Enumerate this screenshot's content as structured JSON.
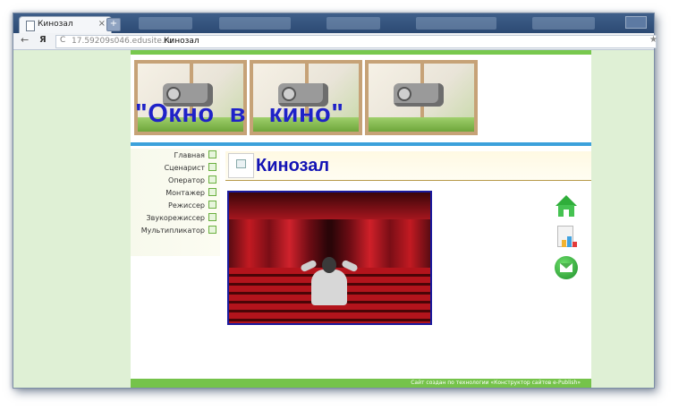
{
  "browser": {
    "tab_title": "Кинозал",
    "tab_close": "×",
    "new_tab": "+",
    "nav_back": "←",
    "nav_yandex": "Я",
    "reload": "C",
    "url": "17.59209s046.edusite.ru",
    "page_title_in_bar": "Кинозал",
    "star": "★"
  },
  "site": {
    "title": "\"Окно  в   кино\"",
    "page_heading": "Кинозал",
    "menu": [
      {
        "label": "Главная"
      },
      {
        "label": "Сценарист"
      },
      {
        "label": "Оператор"
      },
      {
        "label": "Монтажер"
      },
      {
        "label": "Режиссер"
      },
      {
        "label": "Звукорежиссер"
      },
      {
        "label": "Мультипликатор"
      }
    ],
    "footer": "Сайт создан по технологии «Конструктор сайтов e-Publish»"
  },
  "colors": {
    "accent_green": "#78c84e",
    "accent_blue": "#3ca1db",
    "title_blue": "#1f22c8"
  },
  "icons": [
    "home-icon",
    "sitemap-icon",
    "mail-icon"
  ]
}
